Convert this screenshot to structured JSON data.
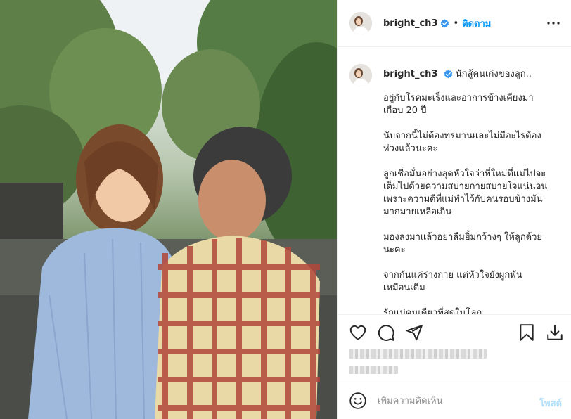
{
  "post": {
    "username": "bright_ch3",
    "separator": "•",
    "follow_label": "ติดตาม",
    "caption_first_line": "นักสู้คนเก่งของลูก..",
    "caption_paragraphs": [
      "อยู่กับโรคมะเร็งและอาการข้างเคียงมา\nเกือบ 20 ปี",
      "นับจากนี้ไม่ต้องทรมานและไม่มีอะไรต้อง\nห่วงแล้วนะคะ",
      "ลูกเชื่อมั่นอย่างสุดหัวใจว่าที่ใหม่ที่แม่ไปจะ\nเต็มไปด้วยความสบายกายสบายใจแน่นอน\nเพราะความดีที่แม่ทำไว้กับคนรอบข้างมัน\nมากมายเหลือเกิน",
      "มองลงมาแล้วอย่าลืมยิ้มกว้างๆ ให้ลูกด้วย\nนะคะ",
      "จากกันแค่ร่างกาย แต่หัวใจยังผูกพัน\nเหมือนเดิม",
      "รักแม่คนเดียวที่สุดในโลก"
    ],
    "comment_placeholder": "เพิ่มความคิดเห็น",
    "post_button_label": "โพสต์"
  },
  "icons": {
    "verified": "verified-badge-icon",
    "more": "more-options-icon",
    "like": "heart-icon",
    "comment": "comment-icon",
    "share": "share-icon",
    "save": "bookmark-icon",
    "download": "download-icon",
    "emoji": "emoji-icon"
  },
  "colors": {
    "accent": "#0095f6",
    "post_disabled": "#b2dffc",
    "text": "#262626",
    "muted": "#8e8e8e",
    "divider": "#efefef"
  }
}
